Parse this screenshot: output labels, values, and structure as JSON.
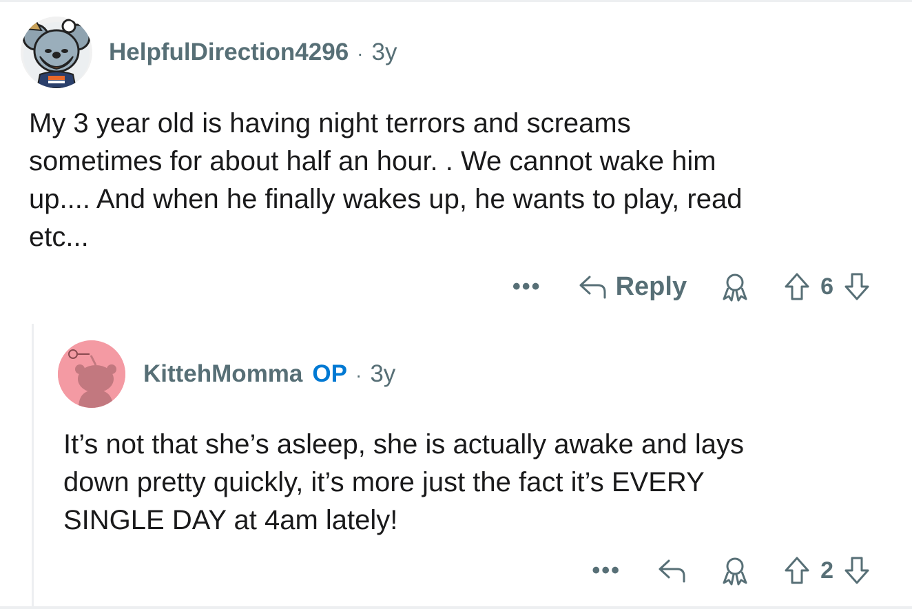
{
  "comments": [
    {
      "author": "HelpfulDirection4296",
      "age": "3y",
      "separator": "·",
      "body": "My 3 year old is having night terrors and screams\nsometimes for about half an hour. . We cannot wake him\nup.... And when he finally wakes up, he wants to play, read\netc...",
      "actions": {
        "more": "•••",
        "reply_label": "Reply",
        "score": "6"
      },
      "avatar_icon": "koala-avatar"
    },
    {
      "author": "KittehMomma",
      "badge": "OP",
      "age": "3y",
      "separator": "·",
      "body": "It’s not that she’s asleep, she is actually awake and lays\ndown pretty quickly, it’s more just the fact it’s EVERY\nSINGLE DAY at 4am lately!",
      "actions": {
        "more": "•••",
        "score": "2"
      },
      "avatar_icon": "snoo-avatar"
    }
  ],
  "colors": {
    "meta_gray": "#576f76",
    "op_blue": "#0079d3",
    "avatar_pink": "#f49aa3",
    "text": "#1a1a1b"
  }
}
